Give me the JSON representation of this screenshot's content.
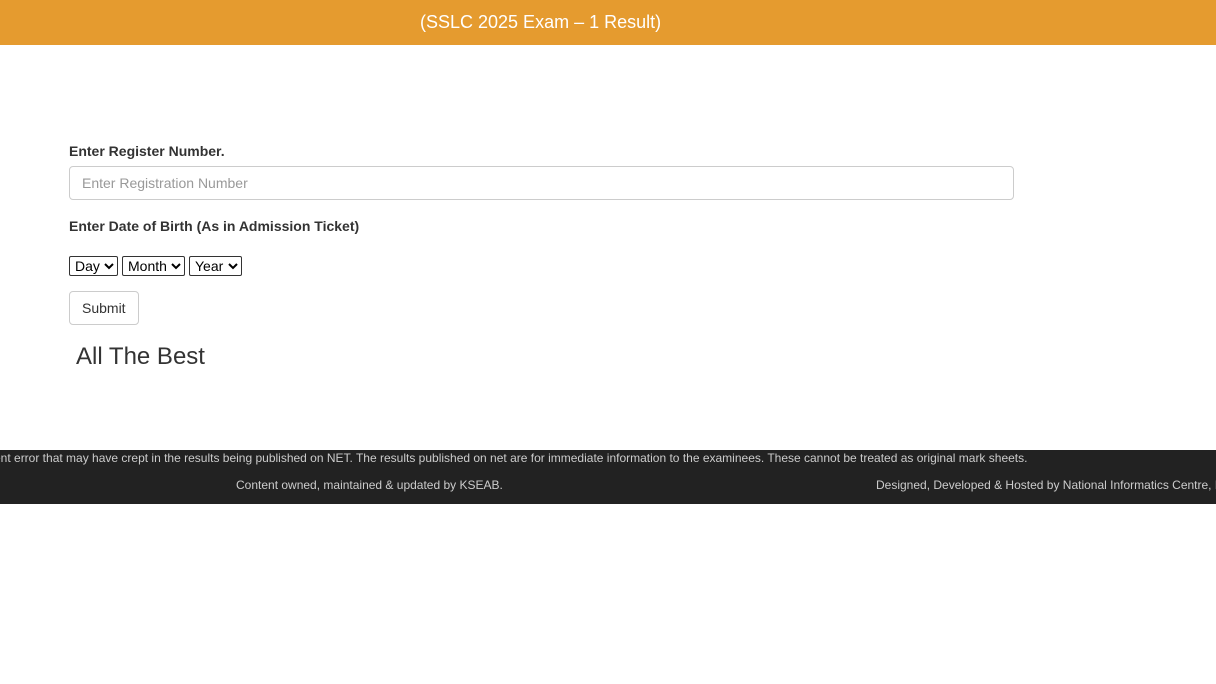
{
  "header": {
    "title": "(SSLC 2025 Exam – 1 Result)",
    "bg_color": "#e59b2f"
  },
  "form": {
    "register_label": "Enter Register Number.",
    "register_placeholder": "Enter Registration Number",
    "register_value": "",
    "dob_label": "Enter Date of Birth (As in Admission Ticket)",
    "day_selected": "Day",
    "month_selected": "Month",
    "year_selected": "Year",
    "submit_label": "Submit"
  },
  "greeting": "All The Best",
  "footer": {
    "disclaimer": "ent error that may have crept in the results being published on NET. The results published on net are for immediate information to the examinees. These cannot be treated as original mark sheets.",
    "owned": "Content owned, maintained & updated by KSEAB.",
    "designed": "Designed, Developed & Hosted by National Informatics Centre, Ka",
    "bg_color": "#222222"
  }
}
